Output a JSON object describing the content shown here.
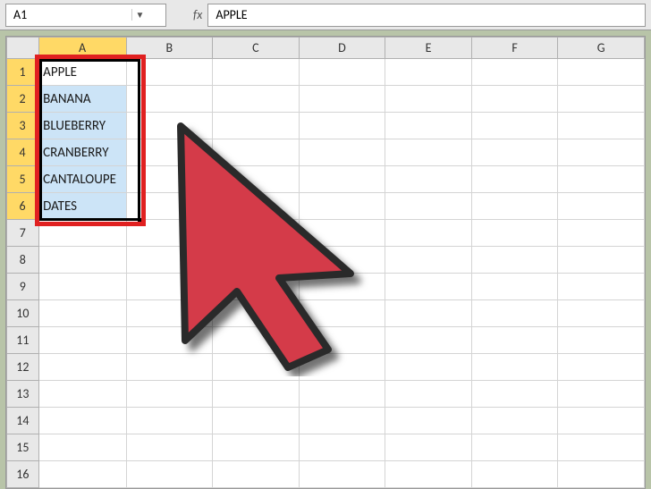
{
  "nameBox": {
    "value": "A1"
  },
  "formulaBar": {
    "fxLabel": "fx",
    "value": "APPLE"
  },
  "columns": [
    "A",
    "B",
    "C",
    "D",
    "E",
    "F",
    "G"
  ],
  "activeColumn": "A",
  "rows": [
    1,
    2,
    3,
    4,
    5,
    6,
    7,
    8,
    9,
    10,
    11,
    12,
    13,
    14,
    15,
    16
  ],
  "activeRows": [
    1,
    2,
    3,
    4,
    5,
    6
  ],
  "cells": {
    "A1": "APPLE",
    "A2": "BANANA",
    "A3": "BLUEBERRY",
    "A4": "CRANBERRY",
    "A5": "CANTALOUPE",
    "A6": "DATES"
  },
  "selection": {
    "startRow": 1,
    "endRow": 6,
    "col": "A"
  }
}
